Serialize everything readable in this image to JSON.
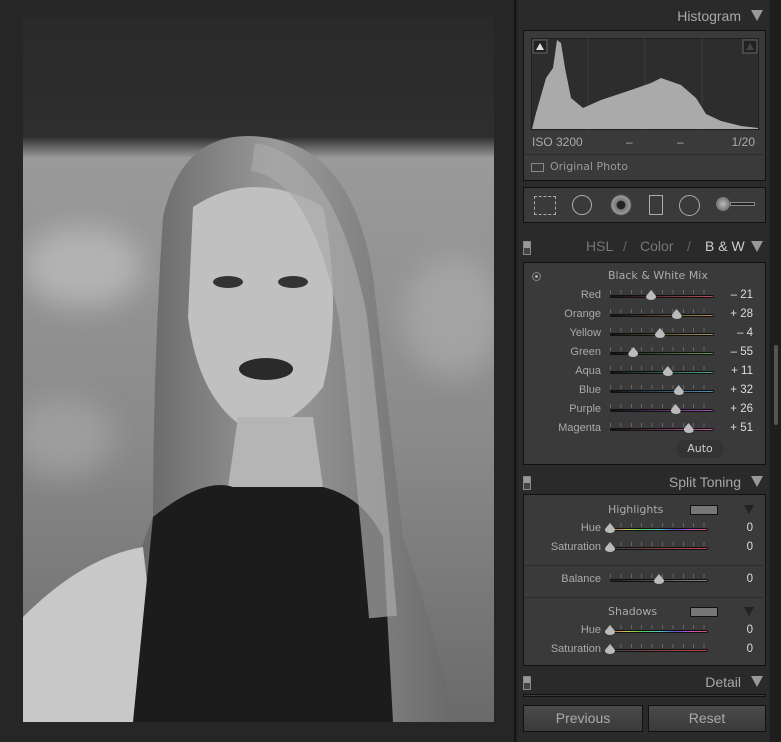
{
  "histogram": {
    "title": "Histogram",
    "iso": "ISO 3200",
    "focal": "–",
    "aperture": "–",
    "shutter": "1/20",
    "original_photo": "Original Photo"
  },
  "tools": [
    "crop-overlay",
    "spot-removal",
    "red-eye",
    "graduated-filter",
    "radial-filter",
    "adjustment-brush"
  ],
  "hsl": {
    "hsl": "HSL",
    "sep1": "/",
    "color": "Color",
    "sep2": "/",
    "bw": "B & W"
  },
  "bw_mix": {
    "title": "Black & White Mix",
    "auto": "Auto",
    "sliders": [
      {
        "label": "Red",
        "value": -21,
        "display": "– 21",
        "color": "#c05060"
      },
      {
        "label": "Orange",
        "value": 28,
        "display": "+ 28",
        "color": "#b08a5a"
      },
      {
        "label": "Yellow",
        "value": -4,
        "display": "– 4",
        "color": "#a89a5a"
      },
      {
        "label": "Green",
        "value": -55,
        "display": "– 55",
        "color": "#6aa050"
      },
      {
        "label": "Aqua",
        "value": 11,
        "display": "+ 11",
        "color": "#50a898"
      },
      {
        "label": "Blue",
        "value": 32,
        "display": "+ 32",
        "color": "#5890b8"
      },
      {
        "label": "Purple",
        "value": 26,
        "display": "+ 26",
        "color": "#a050b8"
      },
      {
        "label": "Magenta",
        "value": 51,
        "display": "+ 51",
        "color": "#c060a0"
      }
    ]
  },
  "split_toning": {
    "title": "Split Toning",
    "highlights": "Highlights",
    "shadows": "Shadows",
    "balance_label": "Balance",
    "balance": "0",
    "h_hue_label": "Hue",
    "h_hue": "0",
    "h_sat_label": "Saturation",
    "h_sat": "0",
    "s_hue_label": "Hue",
    "s_hue": "0",
    "s_sat_label": "Saturation",
    "s_sat": "0"
  },
  "detail": {
    "title": "Detail"
  },
  "buttons": {
    "previous": "Previous",
    "reset": "Reset"
  }
}
